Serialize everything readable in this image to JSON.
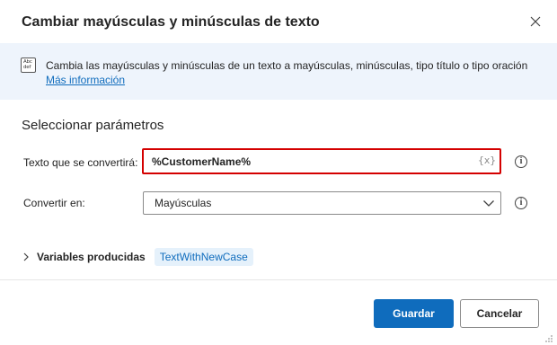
{
  "dialog": {
    "title": "Cambiar mayúsculas y minúsculas de texto",
    "close_icon": "close-icon"
  },
  "banner": {
    "icon": "text-case-icon",
    "icon_text": "Abc def",
    "description": "Cambia las mayúsculas y minúsculas de un texto a mayúsculas, minúsculas, tipo título o tipo oración",
    "link": "Más información",
    "background": "#eef4fc"
  },
  "parameters": {
    "section_title": "Seleccionar parámetros",
    "text_field": {
      "label": "Texto que se convertirá:",
      "value": "%CustomerName%",
      "variable_button": "{x}",
      "border_color": "#d40000"
    },
    "convert_field": {
      "label": "Convertir en:",
      "selected": "Mayúsculas"
    }
  },
  "variables": {
    "label": "Variables producidas",
    "items": [
      "TextWithNewCase"
    ]
  },
  "footer": {
    "save_label": "Guardar",
    "cancel_label": "Cancelar",
    "accent": "#0f6cbd"
  }
}
